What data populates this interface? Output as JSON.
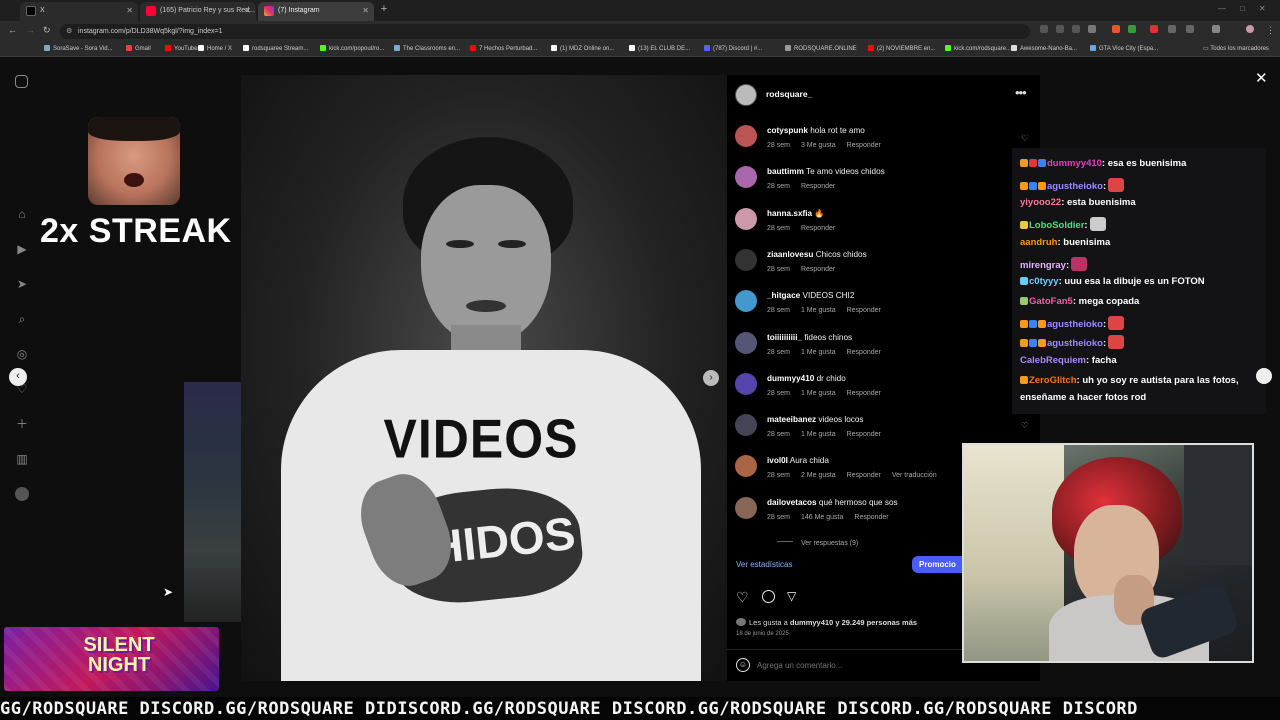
{
  "browser": {
    "tabs": [
      {
        "label": "X",
        "color": "#000000"
      },
      {
        "label": "(165) Patricio Rey y sus Red...",
        "color": "#ff0033"
      },
      {
        "label": "(7) Instagram",
        "color": "#e1306c"
      }
    ],
    "new_tab": "+",
    "url": "instagram.com/p/DLD38Wq5kgl/?img_index=1",
    "bookmarks": [
      {
        "label": "SoraSave - Sora Vid...",
        "color": "#7ab"
      },
      {
        "label": "Gmail",
        "color": "#ea4335"
      },
      {
        "label": "YouTube",
        "color": "#ff0000"
      },
      {
        "label": "Home / X",
        "color": "#ffffff"
      },
      {
        "label": "rodsquaree Stream...",
        "color": "#ffffff"
      },
      {
        "label": "kick.com/popout/ro...",
        "color": "#53fc18"
      },
      {
        "label": "The Classrooms en...",
        "color": "#7ad"
      },
      {
        "label": "7 Hechos Perturbad...",
        "color": "#ff0000"
      },
      {
        "label": "(1) MDZ Online on...",
        "color": "#ffffff"
      },
      {
        "label": "(13) EL CLUB DE...",
        "color": "#ffffff"
      },
      {
        "label": "(787) Discord | #...",
        "color": "#5865f2"
      },
      {
        "label": "RODSQUARE.ONLINE",
        "color": "#999999"
      },
      {
        "label": "(2) NOVIEMBRE en...",
        "color": "#ff0000"
      },
      {
        "label": "kick.com/rodsquare...",
        "color": "#53fc18"
      },
      {
        "label": "Awesome-Nano-Ba...",
        "color": "#dddddd"
      },
      {
        "label": "GTA Vice City (Espa...",
        "color": "#6ae"
      }
    ],
    "all_bookmarks": "Todos los marcadores"
  },
  "overlay": {
    "streak": "2x STREAK",
    "silent_night": "SILENT NIGHT"
  },
  "post": {
    "username": "rodsquare_",
    "shirt_line1": "VIDEOS",
    "shirt_line2": "CHIDOS",
    "comments": [
      {
        "user": "cotyspunk",
        "text": "hola rot te amo",
        "time": "28 sem",
        "likes": "3 Me gusta",
        "reply": "Responder",
        "extra": "",
        "color": "#b55"
      },
      {
        "user": "bauttimm",
        "text": "Te amo videos chidos",
        "time": "28 sem",
        "likes": "",
        "reply": "Responder",
        "extra": "",
        "color": "#a6a"
      },
      {
        "user": "hanna.sxfia",
        "text": "🔥",
        "time": "28 sem",
        "likes": "",
        "reply": "Responder",
        "extra": "",
        "color": "#c9a"
      },
      {
        "user": "ziaanlovesu",
        "text": "Chicos chidos",
        "time": "28 sem",
        "likes": "",
        "reply": "Responder",
        "extra": "",
        "color": "#333"
      },
      {
        "user": "_hitgace",
        "text": "VIDEOS CHI2",
        "time": "28 sem",
        "likes": "1 Me gusta",
        "reply": "Responder",
        "extra": "",
        "color": "#49c"
      },
      {
        "user": "toiiiiiiiiii_",
        "text": "fideos chinos",
        "time": "28 sem",
        "likes": "1 Me gusta",
        "reply": "Responder",
        "extra": "",
        "color": "#557"
      },
      {
        "user": "dummyy410",
        "text": "dr chido",
        "time": "28 sem",
        "likes": "1 Me gusta",
        "reply": "Responder",
        "extra": "",
        "color": "#54a"
      },
      {
        "user": "mateeibanez",
        "text": "videos locos",
        "time": "28 sem",
        "likes": "1 Me gusta",
        "reply": "Responder",
        "extra": "",
        "color": "#445"
      },
      {
        "user": "ivol0l",
        "text": "Aura chida",
        "time": "28 sem",
        "likes": "2 Me gusta",
        "reply": "Responder",
        "extra": "Ver traducción",
        "color": "#a64"
      },
      {
        "user": "dailovetacos",
        "text": "qué hermoso que sos",
        "time": "28 sem",
        "likes": "146 Me gusta",
        "reply": "Responder",
        "extra": "",
        "color": "#865"
      }
    ],
    "view_replies": "Ver respuestas (9)",
    "view_stats": "Ver estadísticas",
    "promote": "Promocio",
    "likes_line_prefix": "Les gusta a ",
    "likes_user": "dummyy410",
    "likes_line_suffix": " y 29.249 personas más",
    "date": "18 de junio de 2025",
    "add_comment_placeholder": "Agrega un comentario..."
  },
  "chat": [
    {
      "user": "dummyy410",
      "user_color": "#e13fc0",
      "badges": [
        "#f59a1b",
        "#e33",
        "#3b82f6"
      ],
      "msg": ": esa es buenisima",
      "emote": ""
    },
    {
      "user": "agustheioko",
      "user_color": "#9b8cff",
      "badges": [
        "#f59a1b",
        "#3b82f6",
        "#f59a1b"
      ],
      "msg": ":",
      "emote": "#d44"
    },
    {
      "user": "yiyooo22",
      "user_color": "#ff7b9c",
      "badges": [],
      "msg": ": esta buenisima",
      "emote": ""
    },
    {
      "user": "LoboSoldier",
      "user_color": "#4ade80",
      "badges": [
        "#e7c84a"
      ],
      "msg": ":",
      "emote": "#ccc"
    },
    {
      "user": "aandruh",
      "user_color": "#f59a1b",
      "badges": [],
      "msg": ": buenisima",
      "emote": ""
    },
    {
      "user": "mirengray",
      "user_color": "#e5b5ff",
      "badges": [],
      "msg": ":",
      "emote": "#b36"
    },
    {
      "user": "c0tyyy",
      "user_color": "#7cf",
      "badges": [
        "#6cf"
      ],
      "msg": ": uuu esa la dibuje es un FOTON",
      "emote": ""
    },
    {
      "user": "GatoFan5",
      "user_color": "#ff5aa8",
      "badges": [
        "#9c6"
      ],
      "msg": ": mega copada",
      "emote": ""
    },
    {
      "user": "agustheioko",
      "user_color": "#9b8cff",
      "badges": [
        "#f59a1b",
        "#3b82f6",
        "#f59a1b"
      ],
      "msg": ":",
      "emote": "#d44"
    },
    {
      "user": "agustheioko",
      "user_color": "#9b8cff",
      "badges": [
        "#f59a1b",
        "#3b82f6",
        "#f59a1b"
      ],
      "msg": ":",
      "emote": "#d44"
    },
    {
      "user": "CalebRequiem",
      "user_color": "#a78bfa",
      "badges": [],
      "msg": ": facha",
      "emote": ""
    },
    {
      "user": "ZeroGlitch",
      "user_color": "#f97316",
      "badges": [
        "#f59a1b"
      ],
      "msg": ": uh yo soy re autista para las fotos,",
      "emote": ""
    }
  ],
  "chat_continuation": "enseñame a hacer fotos rod",
  "ticker": "GG/RODSQUARE DISCORD.GG/RODSQUARE DIDISCORD.GG/RODSQUARE DISCORD.GG/RODSQUARE DISCORD.GG/RODSQUARE DISCORD"
}
